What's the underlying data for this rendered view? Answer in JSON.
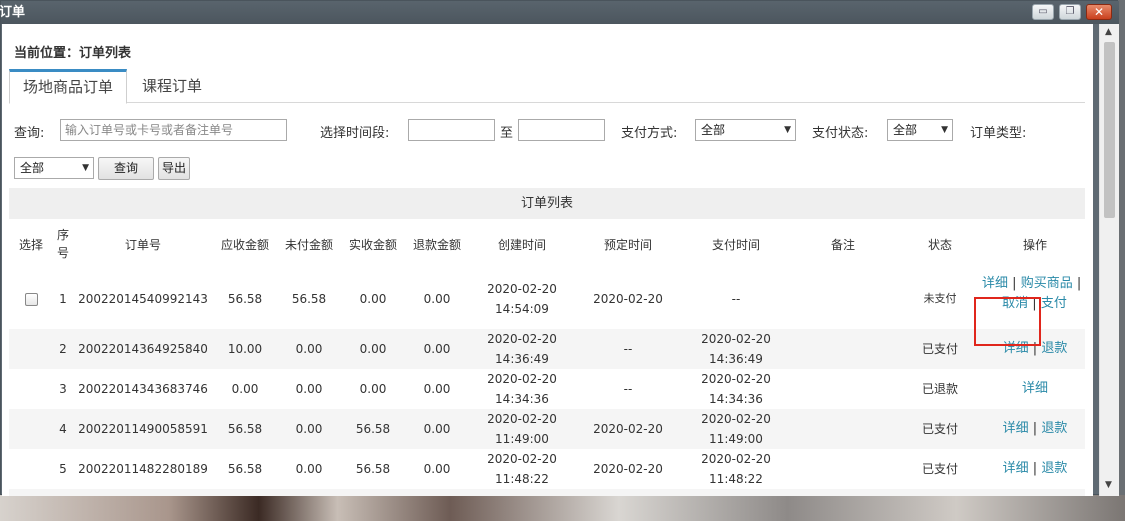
{
  "window": {
    "title": "订单",
    "minimize_icon": "minimize-icon",
    "maximize_icon": "restore-icon",
    "close_icon": "close-icon"
  },
  "breadcrumb": "当前位置：订单列表",
  "tabs": [
    {
      "label": "场地商品订单",
      "active": true
    },
    {
      "label": "课程订单",
      "active": false
    }
  ],
  "filters": {
    "query_label": "查询:",
    "query_placeholder": "输入订单号或卡号或者备注单号",
    "time_label": "选择时间段:",
    "time_to": "至",
    "pay_method_label": "支付方式:",
    "pay_method_value": "全部",
    "pay_status_label": "支付状态:",
    "pay_status_value": "全部",
    "order_type_label": "订单类型:",
    "order_type_value": "全部",
    "search_button": "查询",
    "export_button": "导出"
  },
  "grid": {
    "caption": "订单列表",
    "columns": [
      "选择",
      "序号",
      "订单号",
      "应收金额",
      "未付金额",
      "实收金额",
      "退款金额",
      "创建时间",
      "预定时间",
      "支付时间",
      "备注",
      "状态",
      "操作"
    ],
    "rows": [
      {
        "seq": "1",
        "order_no": "20022014540992143",
        "receivable": "56.58",
        "unpaid": "56.58",
        "received": "0.00",
        "refund": "0.00",
        "created_date": "2020-02-20",
        "created_time": "14:54:09",
        "booked": "2020-02-20",
        "paid_date": "--",
        "paid_time": "",
        "note": "",
        "status": "未支付",
        "ops": [
          "详细",
          "购买商品",
          "取消",
          "支付"
        ]
      },
      {
        "seq": "2",
        "order_no": "20022014364925840",
        "receivable": "10.00",
        "unpaid": "0.00",
        "received": "0.00",
        "refund": "0.00",
        "created_date": "2020-02-20",
        "created_time": "14:36:49",
        "booked": "--",
        "paid_date": "2020-02-20",
        "paid_time": "14:36:49",
        "note": "",
        "status": "已支付",
        "ops": [
          "详细",
          "退款"
        ]
      },
      {
        "seq": "3",
        "order_no": "20022014343683746",
        "receivable": "0.00",
        "unpaid": "0.00",
        "received": "0.00",
        "refund": "0.00",
        "created_date": "2020-02-20",
        "created_time": "14:34:36",
        "booked": "--",
        "paid_date": "2020-02-20",
        "paid_time": "14:34:36",
        "note": "",
        "status": "已退款",
        "ops": [
          "详细"
        ]
      },
      {
        "seq": "4",
        "order_no": "20022011490058591",
        "receivable": "56.58",
        "unpaid": "0.00",
        "received": "56.58",
        "refund": "0.00",
        "created_date": "2020-02-20",
        "created_time": "11:49:00",
        "booked": "2020-02-20",
        "paid_date": "2020-02-20",
        "paid_time": "11:49:00",
        "note": "",
        "status": "已支付",
        "ops": [
          "详细",
          "退款"
        ]
      },
      {
        "seq": "5",
        "order_no": "20022011482280189",
        "receivable": "56.58",
        "unpaid": "0.00",
        "received": "56.58",
        "refund": "0.00",
        "created_date": "2020-02-20",
        "created_time": "11:48:22",
        "booked": "2020-02-20",
        "paid_date": "2020-02-20",
        "paid_time": "11:48:22",
        "note": "",
        "status": "已支付",
        "ops": [
          "详细",
          "退款"
        ]
      }
    ],
    "op_separator": "|"
  },
  "colors": {
    "accent": "#3a8cc4",
    "link": "#2a8aa8",
    "unpaid": "#d9001b",
    "received": "#3a8a1f",
    "refund": "#1f5ea8",
    "highlight": "#e0261c"
  }
}
